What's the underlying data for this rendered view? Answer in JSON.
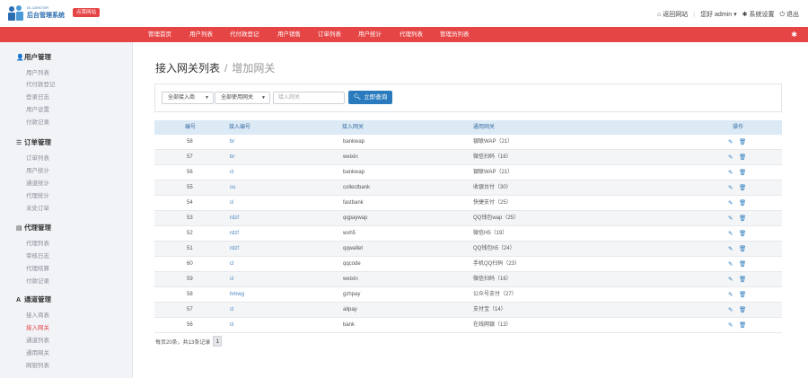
{
  "brand": {
    "small": "DI-CENTER",
    "name": "后台管理系统",
    "badge": "点菜网站"
  },
  "top_right": {
    "home_label": "返回网站",
    "user_label": "您好 admin",
    "settings_label": "系统设置",
    "logout_label": "退出"
  },
  "nav": {
    "items": [
      "管理首页",
      "用户列表",
      "代付款登记",
      "用户销售",
      "订单列表",
      "用户统计",
      "代理列表",
      "管理员列表"
    ]
  },
  "sidebar": {
    "groups": [
      {
        "title": "用户管理",
        "items": [
          "用户列表",
          "代付款登记",
          "登录日志",
          "用户设置",
          "付款记录"
        ]
      },
      {
        "title": "订单管理",
        "items": [
          "订单列表",
          "用户统计",
          "通道统计",
          "代理统计",
          "未处订单"
        ]
      },
      {
        "title": "代理管理",
        "items": [
          "代理列表",
          "审核日志",
          "代理结算",
          "付款记录"
        ]
      },
      {
        "title": "通道管理",
        "items": [
          "接入商表",
          "接入网关",
          "通道列表",
          "通用网关",
          "网银列表"
        ]
      }
    ],
    "active_item": "接入网关"
  },
  "page": {
    "title": "接入网关列表",
    "sub": "增加网关"
  },
  "filters": {
    "select1": "全部接入商",
    "select2": "全部使用网关",
    "search_placeholder": "接入网关",
    "search_button": "立即查询"
  },
  "table": {
    "headers": [
      "编号",
      "接入编号",
      "接入网关",
      "通用网关",
      "操作"
    ],
    "rows": [
      [
        "58",
        "br",
        "bankwap",
        "银联WAP（21）"
      ],
      [
        "57",
        "br",
        "weixin",
        "微信扫码（16）"
      ],
      [
        "56",
        "cl",
        "bankwap",
        "银联WAP（21）"
      ],
      [
        "55",
        "cu",
        "collectbank",
        "收银台付（30）"
      ],
      [
        "54",
        "cl",
        "fastbank",
        "快捷支付（25）"
      ],
      [
        "53",
        "rdzf",
        "qqpaywap",
        "QQ钱包wap（25）"
      ],
      [
        "52",
        "rdzf",
        "wxh5",
        "微信H5（19）"
      ],
      [
        "51",
        "rdzf",
        "qqwallet",
        "QQ钱包h5（24）"
      ],
      [
        "60",
        "cl",
        "qqcode",
        "手机QQ扫码（23）"
      ],
      [
        "59",
        "cl",
        "weixin",
        "微信扫码（16）"
      ],
      [
        "58",
        "hmwg",
        "gzhpay",
        "公众号支付（27）"
      ],
      [
        "57",
        "cl",
        "alipay",
        "支付宝（14）"
      ],
      [
        "56",
        "cl",
        "bank",
        "在线网银（13）"
      ]
    ]
  },
  "pager": {
    "summary": "每页20条，共13条记录",
    "current_page": "1"
  },
  "colors": {
    "accent": "#e64545",
    "primary": "#2a7bbd",
    "header_bg": "#dceaf5"
  }
}
